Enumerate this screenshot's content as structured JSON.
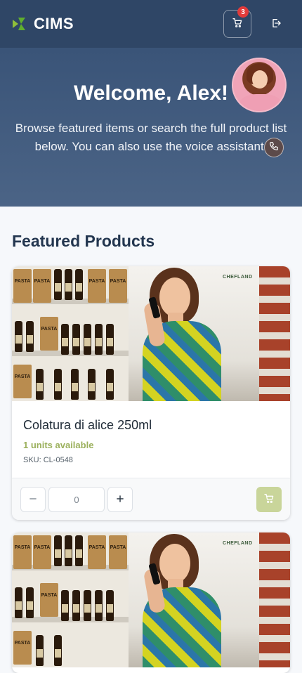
{
  "header": {
    "app_name": "CIMS",
    "cart_count": "3"
  },
  "hero": {
    "title": "Welcome, Alex!",
    "subtitle": "Browse featured items or search the full product list below. You can also use the voice assistant."
  },
  "featured": {
    "title": "Featured Products",
    "products": [
      {
        "name": "Colatura di alice 250ml",
        "stock": "1 units available",
        "sku": "SKU: CL-0548",
        "quantity": "0",
        "photo_text": {
          "bag_label": "PASTA",
          "store": "CHEFLAND"
        }
      }
    ]
  },
  "colors": {
    "header_bg": "#2f4666",
    "hero_bg": "#3a5478",
    "stock_green": "#9bb05c",
    "add_to_cart_bg": "#c9d59a",
    "badge_red": "#e23b3b"
  }
}
